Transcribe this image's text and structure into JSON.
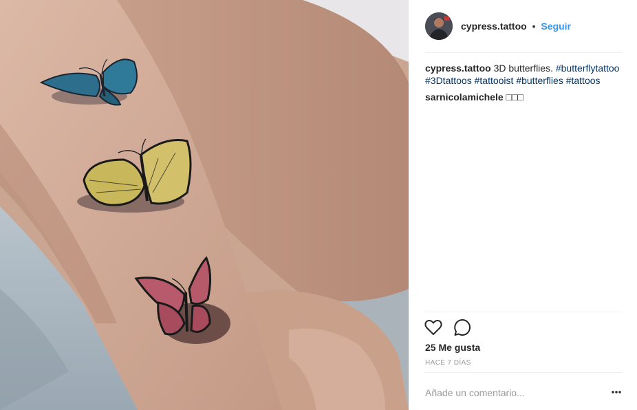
{
  "post": {
    "username": "cypress.tattoo",
    "separator": "•",
    "follow_label": "Seguir",
    "caption": {
      "username": "cypress.tattoo",
      "text": " 3D butterflies. ",
      "hashtags": [
        "#butterflytattoo",
        "#3Dtattoos",
        "#tattooist",
        "#butterflies",
        "#tattoos"
      ]
    },
    "comment": {
      "username": "sarnicolamichele",
      "text": " □□□"
    },
    "likes_label": "25 Me gusta",
    "time_label": "HACE 7 DÍAS",
    "comment_placeholder": "Añade un comentario..."
  },
  "icons": {
    "like": "heart-icon",
    "comment": "speech-bubble-icon",
    "more": "more-options-icon"
  },
  "colors": {
    "accent": "#3897f0",
    "hashtag": "#003569",
    "muted": "#999999",
    "divider": "#efefef"
  }
}
